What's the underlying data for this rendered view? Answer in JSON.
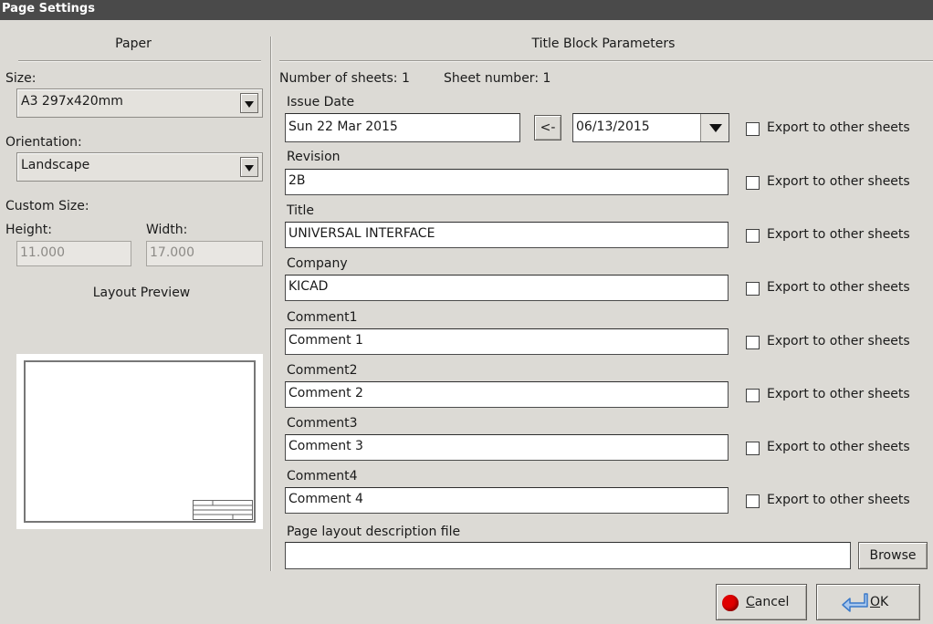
{
  "window": {
    "title": "Page Settings"
  },
  "paper": {
    "section_title": "Paper",
    "size_label": "Size:",
    "size_value": "A3 297x420mm",
    "orientation_label": "Orientation:",
    "orientation_value": "Landscape",
    "custom_size_label": "Custom Size:",
    "height_label": "Height:",
    "width_label": "Width:",
    "height_value": "11.000",
    "width_value": "17.000",
    "preview_label": "Layout Preview"
  },
  "title_block": {
    "section_title": "Title Block Parameters",
    "num_sheets": "Number of sheets: 1",
    "sheet_number": "Sheet number: 1",
    "issue_date_label": "Issue Date",
    "issue_date_value": "Sun 22 Mar 2015",
    "copy_date_button": "<-",
    "date_picker_value": "06/13/2015",
    "export_label": "Export to other sheets",
    "revision_label": "Revision",
    "revision_value": "2B",
    "title_label": "Title",
    "title_value": "UNIVERSAL INTERFACE",
    "company_label": "Company",
    "company_value": "KICAD",
    "comment1_label": "Comment1",
    "comment1_value": "Comment 1",
    "comment2_label": "Comment2",
    "comment2_value": "Comment 2",
    "comment3_label": "Comment3",
    "comment3_value": "Comment 3",
    "comment4_label": "Comment4",
    "comment4_value": "Comment 4",
    "layout_file_label": "Page layout description file",
    "layout_file_value": "",
    "browse_button": "Browse"
  },
  "footer": {
    "cancel_prefix": "",
    "cancel_mnemonic": "C",
    "cancel_rest": "ancel",
    "ok_mnemonic": "O",
    "ok_rest": "K"
  },
  "colors": {
    "titlebar": "#4a4a4a",
    "dialog_bg": "#dcdad5",
    "cancel_icon": "#e00000",
    "ok_icon": "#3a79c9"
  },
  "icons": {
    "cancel": "stop-icon",
    "ok": "return-arrow-icon"
  }
}
